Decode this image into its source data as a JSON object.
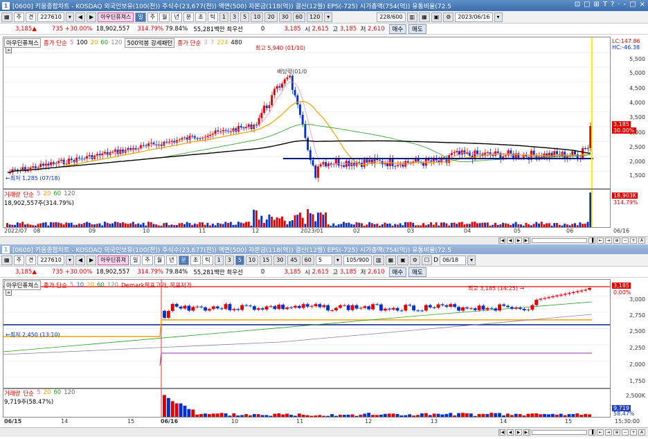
{
  "window": {
    "title_icon": "1",
    "title": "[0600] 키움종합차트 - KOSDAQ 외국인보유(100(천)) 주식수(23,677(천)) 액면(500) 자본금(118(억)) 결산(12월) EPS(-725) 시가총액(754(억)) 유통비율(72.5",
    "controls": [
      "⊡",
      "□",
      "⊞",
      "T",
      "?",
      "·",
      "-",
      "□",
      "×"
    ]
  },
  "top": {
    "toolbar": {
      "kind_1": "주",
      "kind_2": "견",
      "code": "227610",
      "name": "아우딘퓨쳐스",
      "periods": [
        "일",
        "주",
        "월",
        "년",
        "분",
        "초",
        "틱"
      ],
      "minutes": [
        "1",
        "3",
        "5",
        "10",
        "20",
        "30",
        "60",
        "120"
      ],
      "count": "228/600",
      "date": "2023/06/16"
    },
    "quote": {
      "price": "3,185",
      "arrow": "▲",
      "change": "735",
      "pct": "+30.00%",
      "volume": "18,902,557",
      "vol_pct": "314.79%",
      "turnover": "79.84%",
      "amount": "55,281백만",
      "prio": "최우선",
      "prio_val": "0",
      "bid": "3,185",
      "open_label": "시",
      "open": "2,615",
      "high_label": "고",
      "high": "3,185",
      "low_label": "저",
      "low": "2,610",
      "buy": "매수",
      "sell": "매도"
    },
    "legend": {
      "name": "아우딘퓨쳐스",
      "ma_label": "종가 단순",
      "ma": [
        "5",
        "100",
        "20",
        "60",
        "120"
      ],
      "mark": "500억봉 강세패턴",
      "ma2_label": "종가 단순",
      "ma2": [
        "3",
        "7",
        "224",
        "480"
      ]
    },
    "annotations": {
      "high": "최고 5,940 (01/10)",
      "low": "최저 1,285 (07/18)",
      "div": "배당락(01/0"
    },
    "yaxis": [
      "5,500",
      "5,000",
      "4,500",
      "4,000",
      "3,500",
      "3,000",
      "2,500",
      "2,000",
      "1,500"
    ],
    "lc": "LC:147.86",
    "hc": "HC:-46.38",
    "price_tag": "3,185",
    "price_pct": "30.00%",
    "volume_legend": {
      "label": "거래량",
      "ma_label": "단순",
      "ma": [
        "5",
        "20",
        "60",
        "120"
      ],
      "value": "18,902,557주(314.79%)"
    },
    "vol_tag": "18,903K",
    "vol_pct": "314.79%",
    "xaxis": [
      "2022/07",
      "08",
      "09",
      "10",
      "11",
      "12",
      "2023/01",
      "02",
      "03",
      "04",
      "05",
      "06",
      "06/16"
    ]
  },
  "bottom": {
    "window_title": "[0600] 키움종합차트 - KOSDAQ 외국인보유(100(천)) 주식수(23,677(천)) 액면(500) 자본금(118(억)) 결산(12월) EPS(-725) 시가총액(754(억)) 유통비율(72.5",
    "toolbar": {
      "kind_1": "주",
      "kind_2": "견",
      "code": "227610",
      "name": "아우딘퓨쳐",
      "periods": [
        "일",
        "주",
        "월",
        "년",
        "분",
        "초",
        "틱"
      ],
      "minutes": [
        "1",
        "3",
        "5",
        "10",
        "15",
        "30",
        "45",
        "60"
      ],
      "min_sel": "5",
      "count": "105/900",
      "date": "06/18",
      "date_label": "D"
    },
    "quote": {
      "price": "3,185",
      "arrow": "▲",
      "change": "735",
      "pct": "+30.00%",
      "volume": "18,902,557",
      "vol_pct": "314.79%",
      "turnover": "79.84%",
      "amount": "55,281백만",
      "prio": "최우선",
      "prio_val": "0",
      "bid": "3,185",
      "open_label": "시",
      "open": "2,615",
      "high_label": "고",
      "high": "3,185",
      "low_label": "저",
      "low": "2,610",
      "buy": "매수",
      "sell": "매도"
    },
    "legend": {
      "name": "아우딘퓨쳐스",
      "ma_label": "종가 단순",
      "ma": [
        "5",
        "10",
        "20",
        "60",
        "120"
      ],
      "demark": "Demark목표고가, 목표저가"
    },
    "annotations": {
      "high": "최고 3,185 (14:25)",
      "low": "최저 2,450 (13:10)"
    },
    "yaxis": [
      "3,000",
      "2,750",
      "2,500",
      "2,250",
      "2,000",
      "1,750"
    ],
    "price_tag": "3,185",
    "price_pct": "0.00%",
    "volume_legend": {
      "label": "거래량",
      "ma_label": "단순",
      "ma": [
        "5",
        "20",
        "60",
        "120"
      ],
      "value": "9,719주(58.47%)"
    },
    "vol_axis": "2,500K",
    "vol_tag": "9,719",
    "vol_pct": "58.47%",
    "xaxis": [
      "06/15",
      "14",
      "15",
      "06/16",
      "10",
      "11",
      "12",
      "13",
      "14",
      "15",
      "15:30:00"
    ]
  },
  "colors": {
    "up": "#e00000",
    "down": "#0030d0",
    "ma5": "#f090c0",
    "ma20": "#f0a000",
    "ma60": "#20a020",
    "ma120": "#000000",
    "ma224": "#e0c000",
    "support": "#001a80",
    "cursor": "#ffee00",
    "resistance": "#e00000"
  }
}
